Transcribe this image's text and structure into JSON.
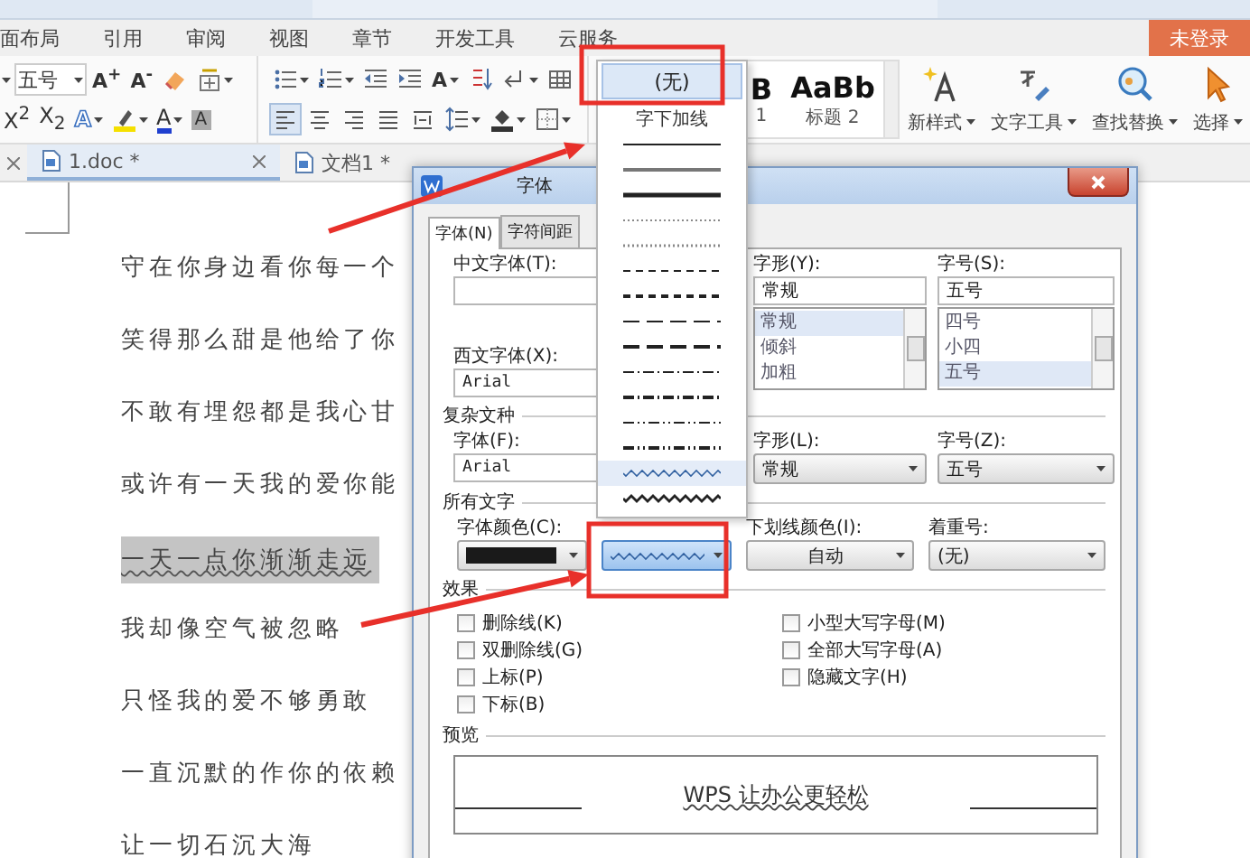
{
  "menu_tabs": [
    {
      "label": "面布局"
    },
    {
      "label": "引用"
    },
    {
      "label": "审阅"
    },
    {
      "label": "视图"
    },
    {
      "label": "章节"
    },
    {
      "label": "开发工具"
    },
    {
      "label": "云服务"
    }
  ],
  "login_button": "未登录",
  "toolbar_groups": [
    {
      "rows": [
        [
          {
            "kind": "field-edge",
            "has_menu": true,
            "on": false
          },
          {
            "kind": "font-size",
            "label": "五号",
            "has_menu": true,
            "on": false
          },
          {
            "kind": "grow-font",
            "label": "A$^{+}$",
            "has_menu": false,
            "on": false
          },
          {
            "kind": "shrink-font",
            "label": "A$^{-}$",
            "has_menu": false,
            "on": false
          },
          {
            "kind": "clear-format",
            "has_menu": false,
            "on": false
          },
          {
            "kind": "pinyin",
            "has_menu": true,
            "on": false
          }
        ],
        [
          {
            "kind": "superscript",
            "label": "X$^{2}$",
            "has_menu": false,
            "on": false
          },
          {
            "kind": "subscript",
            "label": "X$_{2}$",
            "has_menu": false,
            "on": false
          },
          {
            "kind": "text-effect",
            "label": "A",
            "has_menu": true,
            "on": false
          },
          {
            "kind": "highlight",
            "has_menu": true,
            "on": false
          },
          {
            "kind": "font-color",
            "label": "A",
            "has_menu": true,
            "on": false
          },
          {
            "kind": "char-shading",
            "label": "A",
            "has_menu": false,
            "on": false
          }
        ]
      ]
    },
    {
      "rows": [
        [
          {
            "kind": "bullets",
            "has_menu": true,
            "on": false
          },
          {
            "kind": "numbering",
            "has_menu": true,
            "on": false
          },
          {
            "kind": "outdent",
            "has_menu": false,
            "on": false
          },
          {
            "kind": "indent",
            "has_menu": false,
            "on": false
          },
          {
            "kind": "char-scale",
            "label": "A",
            "has_menu": true,
            "on": false
          },
          {
            "kind": "sort",
            "has_menu": false,
            "on": false
          },
          {
            "kind": "marks",
            "has_menu": true,
            "on": false
          },
          {
            "kind": "table",
            "has_menu": false,
            "on": false
          }
        ],
        [
          {
            "kind": "align-left",
            "has_menu": false,
            "on": true
          },
          {
            "kind": "align-center",
            "has_menu": false,
            "on": false
          },
          {
            "kind": "align-right",
            "has_menu": false,
            "on": false
          },
          {
            "kind": "justify",
            "has_menu": false,
            "on": false
          },
          {
            "kind": "distribute",
            "has_menu": false,
            "on": false
          },
          {
            "kind": "line-spacing",
            "has_menu": true,
            "on": false
          },
          {
            "kind": "fill",
            "has_menu": true,
            "on": false
          },
          {
            "kind": "borders",
            "has_menu": true,
            "on": false
          }
        ]
      ]
    }
  ],
  "style_gallery": [
    {
      "sample": "B",
      "name": "1"
    },
    {
      "sample": "AaBb",
      "name": "标题 2"
    }
  ],
  "ribbon_buttons": [
    {
      "kind": "new-style",
      "label": "新样式"
    },
    {
      "kind": "text-tools",
      "label": "文字工具"
    },
    {
      "kind": "find-replace",
      "label": "查找替换"
    },
    {
      "kind": "select",
      "label": "选择"
    }
  ],
  "doc_tabs": [
    {
      "label": "1.doc *",
      "selected": true
    },
    {
      "label": "文档1 *",
      "selected": false
    }
  ],
  "document_lines": [
    {
      "text": "守在你身边看你每一个",
      "selected": false
    },
    {
      "text": "笑得那么甜是他给了你",
      "selected": false
    },
    {
      "text": "不敢有埋怨都是我心甘",
      "selected": false
    },
    {
      "text": "或许有一天我的爱你能",
      "selected": false
    },
    {
      "text": "一天一点你渐渐走远",
      "selected": true
    },
    {
      "text": "我却像空气被忽略",
      "selected": false
    },
    {
      "text": "只怪我的爱不够勇敢",
      "selected": false
    },
    {
      "text": "一直沉默的作你的依赖",
      "selected": false
    },
    {
      "text": "让一切石沉大海",
      "selected": false
    }
  ],
  "font_dialog": {
    "title": "字体",
    "tabs": [
      {
        "label": "字体(N)",
        "selected": true
      },
      {
        "label": "字符间距",
        "selected": false
      }
    ],
    "chinese_font": {
      "label": "中文字体(T):"
    },
    "style": {
      "label": "字形(Y):",
      "value": "常规",
      "options": [
        {
          "label": "常规",
          "selected": true
        },
        {
          "label": "倾斜",
          "selected": false
        },
        {
          "label": "加粗",
          "selected": false
        }
      ]
    },
    "size": {
      "label": "字号(S):",
      "value": "五号",
      "options": [
        {
          "label": "四号",
          "selected": false
        },
        {
          "label": "小四",
          "selected": false
        },
        {
          "label": "五号",
          "selected": true
        }
      ]
    },
    "western_font": {
      "label": "西文字体(X):",
      "value": "Arial"
    },
    "complex_script": {
      "heading": "复杂文种",
      "font": {
        "label": "字体(F):",
        "value": "Arial"
      },
      "style": {
        "label": "字形(L):",
        "value": "常规"
      },
      "size": {
        "label": "字号(Z):",
        "value": "五号"
      }
    },
    "all_text": {
      "heading": "所有文字",
      "font_color": {
        "label": "字体颜色(C):",
        "color": "#1a1a1a"
      },
      "underline_style": {
        "kind": "wave"
      },
      "underline_color": {
        "label": "下划线颜色(I):",
        "value": "自动"
      },
      "emphasis": {
        "label": "着重号:",
        "value": "(无)"
      }
    },
    "effects": {
      "heading": "效果",
      "options": [
        {
          "label": "删除线(K)",
          "checked": false
        },
        {
          "label": "双删除线(G)",
          "checked": false
        },
        {
          "label": "上标(P)",
          "checked": false
        },
        {
          "label": "下标(B)",
          "checked": false
        },
        {
          "label": "小型大写字母(M)",
          "checked": false
        },
        {
          "label": "全部大写字母(A)",
          "checked": false
        },
        {
          "label": "隐藏文字(H)",
          "checked": false
        }
      ]
    },
    "preview": {
      "heading": "预览",
      "sample": "WPS 让办公更轻松"
    }
  },
  "underline_menu": {
    "none_option": {
      "label": "(无)",
      "selected": true
    },
    "section": "字下加线",
    "lines": [
      {
        "kind": "thin",
        "selected": false
      },
      {
        "kind": "medium",
        "selected": false
      },
      {
        "kind": "thick",
        "selected": false
      },
      {
        "kind": "dotted",
        "selected": false
      },
      {
        "kind": "dotted-heavy",
        "selected": false
      },
      {
        "kind": "dash",
        "selected": false
      },
      {
        "kind": "dash-heavy",
        "selected": false
      },
      {
        "kind": "long-dash",
        "selected": false
      },
      {
        "kind": "long-dash-heavy",
        "selected": false
      },
      {
        "kind": "dash-dot",
        "selected": false
      },
      {
        "kind": "dash-dot-heavy",
        "selected": false
      },
      {
        "kind": "dash-dot-dot",
        "selected": false
      },
      {
        "kind": "dash-dot-dot-heavy",
        "selected": false
      },
      {
        "kind": "wave",
        "selected": true
      },
      {
        "kind": "wave-heavy",
        "selected": false
      }
    ]
  }
}
